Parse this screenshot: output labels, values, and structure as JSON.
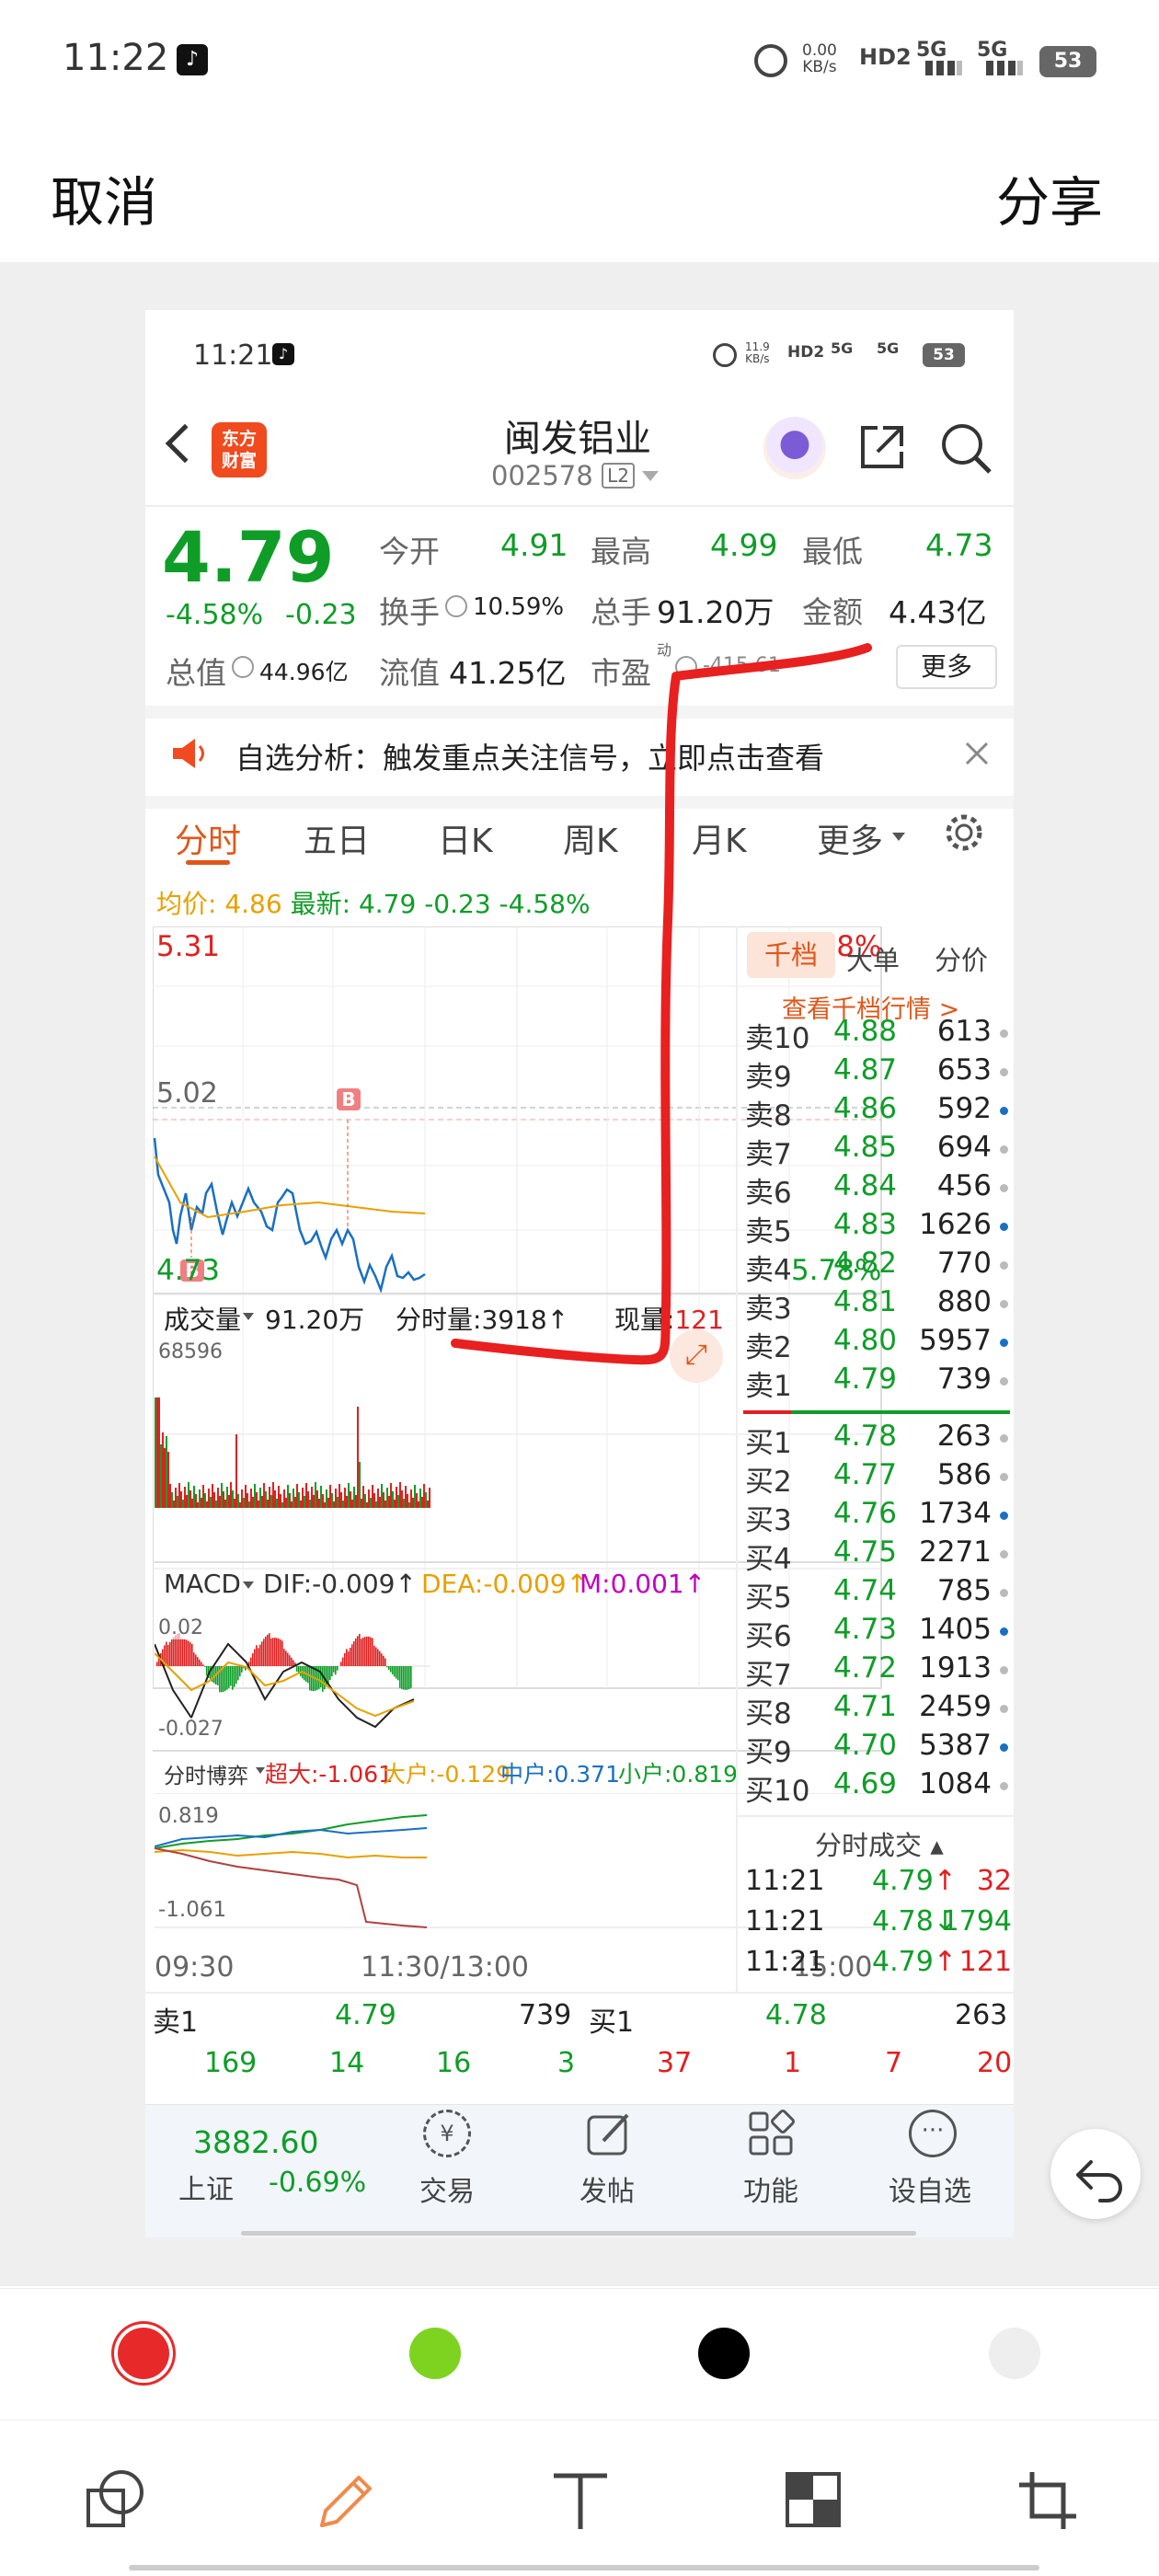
{
  "status": {
    "time": "11:22",
    "netspeed": "0.00\nKB/s",
    "netspeed_top": "0.00",
    "netspeed_bottom": "KB/s",
    "hd": "HD2",
    "sig1": "5G",
    "sig2": "5G",
    "battery": "53"
  },
  "editor": {
    "cancel": "取消",
    "share": "分享"
  },
  "shot": {
    "status": {
      "time": "11:21",
      "speed_top": "11.9",
      "speed_bottom": "KB/s",
      "hd": "HD2",
      "sig1": "5G",
      "sig2": "5G",
      "battery": "53"
    },
    "header": {
      "name": "闽发铝业",
      "code": "002578",
      "level": "L2",
      "app_logo": "东方\n财富",
      "logo_top": "东方",
      "logo_bottom": "财富"
    },
    "quote": {
      "price": "4.79",
      "change_pct": "-4.58%",
      "change": "-0.23",
      "open_label": "今开",
      "open": "4.91",
      "high_label": "最高",
      "high": "4.99",
      "low_label": "最低",
      "low": "4.73",
      "turnover_label": "换手",
      "turnover": "10.59%",
      "volume_label": "总手",
      "volume": "91.20万",
      "amount_label": "金额",
      "amount": "4.43亿",
      "mktcap_label": "总值",
      "mktcap": "44.96亿",
      "float_label": "流值",
      "float": "41.25亿",
      "pe_label": "市盈",
      "pe_sup": "动",
      "pe": "-415.61",
      "more": "更多"
    },
    "notice": {
      "text": "自选分析：触发重点关注信号，立即点击查看"
    },
    "tabs": [
      "分时",
      "五日",
      "日K",
      "周K",
      "月K",
      "更多"
    ],
    "avg_line": {
      "avg_label": "均价:",
      "avg": "4.86",
      "latest_label": "最新:",
      "latest": "4.79",
      "chg": "-0.23",
      "pct": "-4.58%"
    },
    "chart": {
      "top_price": "5.31",
      "top_pct": "5.78%",
      "mid_price": "5.02",
      "bottom_price": "4.73",
      "bottom_pct": "5.78%",
      "marker": "B"
    },
    "volume": {
      "label": "成交量",
      "total": "91.20万",
      "tick_label": "分时量:",
      "tick": "3918",
      "now_label": "现量:",
      "now": "121",
      "max": "68596"
    },
    "macd": {
      "label": "MACD",
      "dif": "DIF:-0.009",
      "dea": "DEA:-0.009",
      "m": "M:0.001",
      "top": "0.02",
      "bottom": "-0.027"
    },
    "flow": {
      "label": "分时博弈",
      "super": "超大:-1.061",
      "big": "大户:-0.129",
      "mid": "中户:0.371",
      "small": "小户:0.819",
      "top": "0.819",
      "bottom": "-1.061"
    },
    "times": [
      "09:30",
      "11:30/13:00",
      "15:00"
    ],
    "ob_tabs": [
      "千档",
      "大单",
      "分价"
    ],
    "ob_link": "查看千档行情 >",
    "asks": [
      {
        "label": "卖10",
        "price": "4.88",
        "vol": "613"
      },
      {
        "label": "卖9",
        "price": "4.87",
        "vol": "653"
      },
      {
        "label": "卖8",
        "price": "4.86",
        "vol": "592"
      },
      {
        "label": "卖7",
        "price": "4.85",
        "vol": "694"
      },
      {
        "label": "卖6",
        "price": "4.84",
        "vol": "456"
      },
      {
        "label": "卖5",
        "price": "4.83",
        "vol": "1626"
      },
      {
        "label": "卖4",
        "price": "4.82",
        "vol": "770"
      },
      {
        "label": "卖3",
        "price": "4.81",
        "vol": "880"
      },
      {
        "label": "卖2",
        "price": "4.80",
        "vol": "5957"
      },
      {
        "label": "卖1",
        "price": "4.79",
        "vol": "739"
      }
    ],
    "bids": [
      {
        "label": "买1",
        "price": "4.78",
        "vol": "263"
      },
      {
        "label": "买2",
        "price": "4.77",
        "vol": "586"
      },
      {
        "label": "买3",
        "price": "4.76",
        "vol": "1734"
      },
      {
        "label": "买4",
        "price": "4.75",
        "vol": "2271"
      },
      {
        "label": "买5",
        "price": "4.74",
        "vol": "785"
      },
      {
        "label": "买6",
        "price": "4.73",
        "vol": "1405"
      },
      {
        "label": "买7",
        "price": "4.72",
        "vol": "1913"
      },
      {
        "label": "买8",
        "price": "4.71",
        "vol": "2459"
      },
      {
        "label": "买9",
        "price": "4.70",
        "vol": "5387"
      },
      {
        "label": "买10",
        "price": "4.69",
        "vol": "1084"
      }
    ],
    "trades_title": "分时成交",
    "trades": [
      {
        "time": "11:21",
        "price": "4.79",
        "dir": "↑",
        "vol": "32"
      },
      {
        "time": "11:21",
        "price": "4.78",
        "dir": "↓",
        "vol": "1794"
      },
      {
        "time": "11:21",
        "price": "4.79",
        "dir": "↑",
        "vol": "121"
      }
    ],
    "summary": {
      "sell_label": "卖1",
      "sell_price": "4.79",
      "sell_vol": "739",
      "buy_label": "买1",
      "buy_price": "4.78",
      "buy_vol": "263",
      "row": [
        "169",
        "14",
        "16",
        "3",
        "37",
        "1",
        "7",
        "20"
      ]
    },
    "bottom": {
      "index": "3882.60",
      "index_name": "上证",
      "index_pct": "-0.69%",
      "items": [
        "交易",
        "发帖",
        "功能",
        "设自选"
      ]
    }
  },
  "palette": {
    "colors": [
      "#e82929",
      "#7ed321",
      "#000000",
      "#eeeeee"
    ]
  },
  "tools": [
    "shapes-icon",
    "pen-icon",
    "text-icon",
    "mosaic-icon",
    "crop-icon"
  ]
}
